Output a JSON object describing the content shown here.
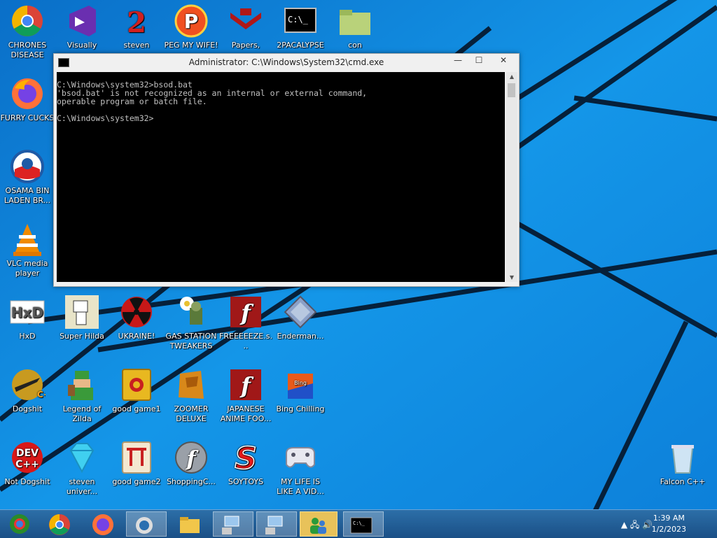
{
  "desktop_icons": [
    {
      "label": "CHRONES DISEASE",
      "icon": "chrome-icon"
    },
    {
      "label": "Visually",
      "icon": "visual-studio-icon"
    },
    {
      "label": "steven",
      "icon": "steven-icon"
    },
    {
      "label": "PEG MY WIFE!",
      "icon": "peg-icon"
    },
    {
      "label": "Papers,",
      "icon": "papers-please-icon"
    },
    {
      "label": "2PACALYPSE",
      "icon": "cmd-icon"
    },
    {
      "label": "con",
      "icon": "folder-icon"
    },
    {
      "label": "FURRY CUCKS",
      "icon": "firefox-icon"
    },
    {
      "label": "OSAMA BIN LADEN BR...",
      "icon": "obama-logo-icon"
    },
    {
      "label": "VLC media player",
      "icon": "vlc-icon"
    },
    {
      "label": "HxD",
      "icon": "hxd-icon"
    },
    {
      "label": "Super Hilda",
      "icon": "super-hilda-icon"
    },
    {
      "label": "UKRAINE!",
      "icon": "radiation-icon"
    },
    {
      "label": "GAS STATION TWEAKERS",
      "icon": "flower-zombie-icon"
    },
    {
      "label": "FREEEEEZE.s...",
      "icon": "flash-icon"
    },
    {
      "label": "Enderman...",
      "icon": "diamond-icon"
    },
    {
      "label": "Dogshit",
      "icon": "codeblocks-icon"
    },
    {
      "label": "Legend of Zilda",
      "icon": "link-sprite-icon"
    },
    {
      "label": "good game1",
      "icon": "mahjong-icon"
    },
    {
      "label": "ZOOMER DELUXE",
      "icon": "zoomer-icon"
    },
    {
      "label": "JAPANESE ANIME FOO...",
      "icon": "flash-icon"
    },
    {
      "label": "Bing Chilling",
      "icon": "bing-chilling-icon"
    },
    {
      "label": "Not Dogshit",
      "icon": "dev-cpp-icon"
    },
    {
      "label": "steven univer...",
      "icon": "gem-icon"
    },
    {
      "label": "good game2",
      "icon": "torii-mahjong-icon"
    },
    {
      "label": "ShoppingC...",
      "icon": "flash-orb-icon"
    },
    {
      "label": "SOYTOYS",
      "icon": "soytoys-icon"
    },
    {
      "label": "MY LIFE IS LIKE A VID...",
      "icon": "gamepad-icon"
    },
    {
      "label": "Falcon C++",
      "icon": "recycle-bin-icon"
    }
  ],
  "cmd_window": {
    "title": "Administrator: C:\\Windows\\System32\\cmd.exe",
    "minimize": "—",
    "maximize": "☐",
    "close": "✕",
    "console_text": "C:\\Windows\\system32>bsod.bat\n'bsod.bat' is not recognized as an internal or external command,\noperable program or batch file.\n\nC:\\Windows\\system32>"
  },
  "taskbar": {
    "items": [
      {
        "name": "start-button"
      },
      {
        "name": "chrome-taskbar"
      },
      {
        "name": "firefox-taskbar"
      },
      {
        "name": "photo-taskbar"
      },
      {
        "name": "explorer-taskbar"
      },
      {
        "name": "network-taskbar-1"
      },
      {
        "name": "network-taskbar-2"
      },
      {
        "name": "users-taskbar"
      },
      {
        "name": "cmd-taskbar"
      }
    ],
    "clock_time": "1:39 AM",
    "clock_date": "1/2/2023",
    "tray_glyphs": "▲  🖧  🔊"
  }
}
